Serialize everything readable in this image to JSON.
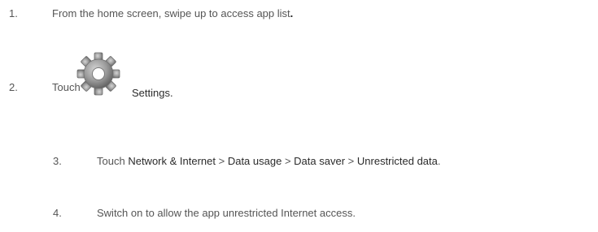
{
  "steps": [
    {
      "number": "1.",
      "text": "From the home screen, swipe up to access app list",
      "trailing": "."
    },
    {
      "number": "2.",
      "prefix": "Touch",
      "icon": "gear-icon",
      "label": "Settings",
      "suffix": "."
    },
    {
      "number": "3.",
      "prefix": "Touch",
      "path": [
        "Network & Internet",
        "Data usage",
        "Data saver",
        "Unrestricted data"
      ],
      "separator": ">",
      "suffix": "."
    },
    {
      "number": "4.",
      "text": "Switch on to allow the app unrestricted Internet access."
    }
  ]
}
